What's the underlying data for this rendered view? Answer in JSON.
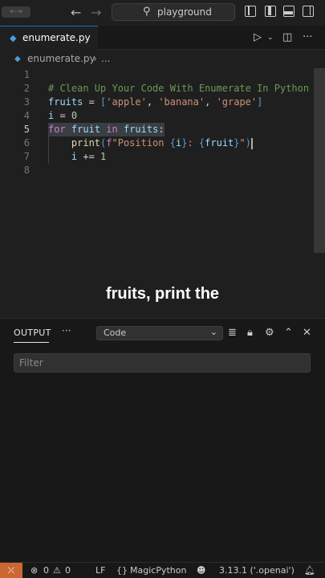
{
  "titlebar": {
    "search_icon": "magnifier-icon",
    "search_text": "playground",
    "back": "←",
    "forward": "→"
  },
  "tab": {
    "filename": "enumerate.py"
  },
  "breadcrumb": {
    "file": "enumerate.py",
    "more": "..."
  },
  "editor": {
    "line_numbers": [
      "1",
      "2",
      "3",
      "4",
      "5",
      "6",
      "7",
      "8"
    ],
    "lines": [
      "",
      "# Clean Up Your Code With Enumerate In Python",
      "fruits = ['apple', 'banana', 'grape']",
      "i = 0",
      "for fruit in fruits:",
      "    print(f\"Position {i}: {fruit}\")",
      "    i += 1",
      ""
    ]
  },
  "caption": "fruits, print the",
  "panel": {
    "tab_label": "OUTPUT",
    "more": "···",
    "channel": "Code",
    "filter_placeholder": "Filter"
  },
  "statusbar": {
    "errors": "0",
    "warnings": "0",
    "eol": "LF",
    "language": "MagicPython",
    "interpreter": "3.13.1 ('.openai')"
  },
  "colors": {
    "accent": "#0078d4",
    "remote": "#cc6633",
    "keyword": "#c586c0",
    "string": "#ce9178",
    "comment": "#6a9955"
  }
}
